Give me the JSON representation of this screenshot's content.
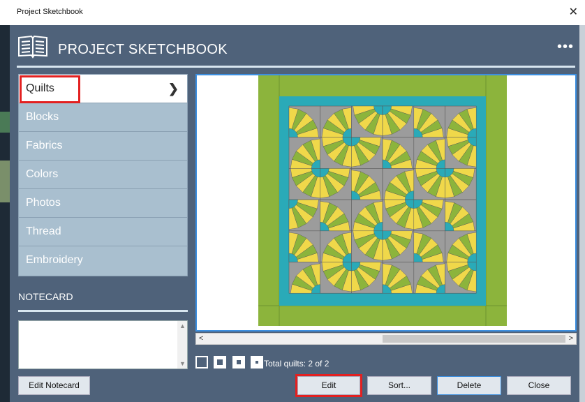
{
  "window": {
    "title": "Project Sketchbook",
    "close_glyph": "✕"
  },
  "header": {
    "app_title": "PROJECT SKETCHBOOK",
    "more_glyph": "•••",
    "icon": "book-icon"
  },
  "categories": {
    "items": [
      {
        "label": "Quilts",
        "selected": true
      },
      {
        "label": "Blocks"
      },
      {
        "label": "Fabrics"
      },
      {
        "label": "Colors"
      },
      {
        "label": "Photos"
      },
      {
        "label": "Thread"
      },
      {
        "label": "Embroidery"
      }
    ],
    "arrow_glyph": "❯"
  },
  "notecard": {
    "title": "NOTECARD",
    "text": ""
  },
  "preview": {
    "scroll_left": "<",
    "scroll_right": ">"
  },
  "status": {
    "total": "Total quilts: 2 of 2"
  },
  "buttons": {
    "edit_notecard": "Edit Notecard",
    "edit": "Edit",
    "sort": "Sort...",
    "delete": "Delete",
    "close": "Close"
  },
  "colors": {
    "background": "#4f627a",
    "list_bg": "#a9bfcf",
    "highlight": "#e32020",
    "accent_blue": "#3c8fe0",
    "quilt_green": "#8cb43c",
    "quilt_teal": "#2aaab8",
    "quilt_yellow": "#f0d84a",
    "quilt_gray": "#9c9c9c"
  }
}
